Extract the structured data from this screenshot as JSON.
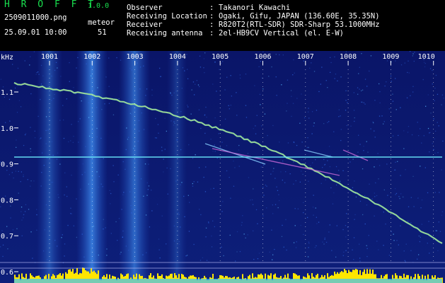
{
  "header": {
    "app_name": "H R O F F T",
    "app_version": "1.0.0",
    "file_name": "2509011000.png",
    "meteor_label": "meteor",
    "date_time": "25.09.01 10:00",
    "meteor_count": "51",
    "info": [
      {
        "label": "Observer",
        "value": "Takanori Kawachi"
      },
      {
        "label": "Receiving Location",
        "value": "Ogaki, Gifu, JAPAN (136.60E, 35.35N)"
      },
      {
        "label": "Receiver",
        "value": "R820T2(RTL-SDR) SDR-Sharp 53.1000MHz"
      },
      {
        "label": "Receiving antenna",
        "value": "2el-HB9CV Vertical (el. E-W)"
      }
    ],
    "separator": ":"
  },
  "plot": {
    "unit_label": "kHz",
    "x_ticks": [
      "1001",
      "1002",
      "1003",
      "1004",
      "1005",
      "1006",
      "1007",
      "1008",
      "1009",
      "1010"
    ],
    "y_ticks": [
      "1.1",
      "1.0",
      "0.9",
      "0.8",
      "0.7",
      "0.6"
    ],
    "colors": {
      "background": "#0a1460",
      "text": "#ffffff",
      "grid": "#ffffff",
      "beacon": "#6ef0ff",
      "baseline": "#ffe600",
      "header_green": "#19e14f"
    }
  }
}
